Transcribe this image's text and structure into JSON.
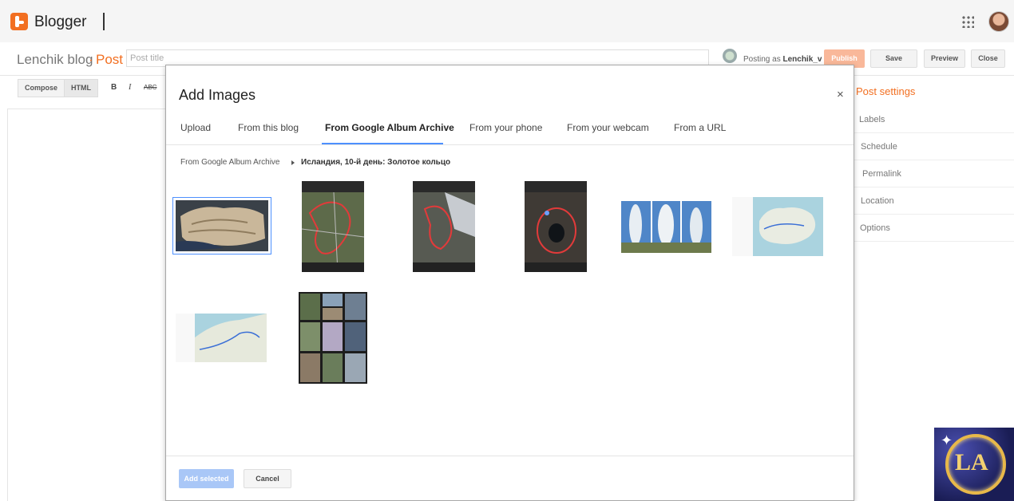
{
  "topbar": {
    "logo_text": "Blogger",
    "apps_icon": "apps-grid-icon",
    "avatar": "user-avatar"
  },
  "editor_header": {
    "blog_name": "Lenchik blog",
    "separator": "·",
    "post_label": "Post",
    "title_placeholder": "Post title",
    "posting_as_prefix": "Posting as",
    "posting_as_user": "Lenchik_v",
    "buttons": {
      "publish": "Publish",
      "save": "Save",
      "preview": "Preview",
      "close": "Close"
    }
  },
  "toolbar": {
    "compose": "Compose",
    "html": "HTML",
    "bold": "B",
    "italic": "I",
    "strike": "ABC"
  },
  "settings": {
    "title": "Post settings",
    "items": [
      "Labels",
      "Schedule",
      "Permalink",
      "Location",
      "Options"
    ]
  },
  "dialog": {
    "title": "Add Images",
    "close": "×",
    "tabs": [
      "Upload",
      "From this blog",
      "From Google Album Archive",
      "From your phone",
      "From your webcam",
      "From a URL"
    ],
    "active_tab": "From Google Album Archive",
    "breadcrumb_root": "From Google Album Archive",
    "breadcrumb_current": "Исландия, 10-й день: Золотое кольцо",
    "images": [
      {
        "name": "aerial-photo",
        "selected": true
      },
      {
        "name": "gps-track-map-1",
        "selected": false
      },
      {
        "name": "gps-track-map-2",
        "selected": false
      },
      {
        "name": "gps-track-map-3",
        "selected": false
      },
      {
        "name": "geyser-photos",
        "selected": false
      },
      {
        "name": "iceland-map",
        "selected": false
      },
      {
        "name": "route-map",
        "selected": false
      },
      {
        "name": "photo-collage",
        "selected": false
      }
    ],
    "footer": {
      "add_selected": "Add selected",
      "cancel": "Cancel"
    }
  },
  "colors": {
    "brand": "#f26f21",
    "accent": "#4d90fe"
  }
}
